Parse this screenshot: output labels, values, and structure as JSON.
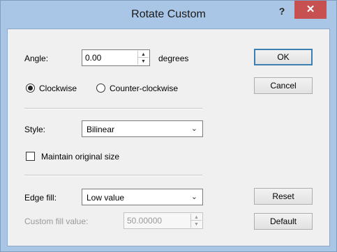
{
  "window": {
    "title": "Rotate Custom",
    "help_label": "?",
    "close_label": "✕"
  },
  "angle": {
    "label": "Angle:",
    "value": "0.00",
    "unit": "degrees"
  },
  "direction": {
    "clockwise_label": "Clockwise",
    "counter_label": "Counter-clockwise",
    "selected": "Clockwise"
  },
  "style": {
    "label": "Style:",
    "value": "Bilinear"
  },
  "maintain": {
    "label": "Maintain original size",
    "checked": false
  },
  "edge_fill": {
    "label": "Edge fill:",
    "value": "Low value"
  },
  "custom_fill": {
    "label": "Custom fill value:",
    "value": "50.00000"
  },
  "buttons": {
    "ok": "OK",
    "cancel": "Cancel",
    "reset": "Reset",
    "default": "Default"
  },
  "icons": {
    "spin_up": "▲",
    "spin_down": "▼",
    "chevron": "⌄"
  },
  "colors": {
    "title_bar": "#a9c6e6",
    "close_button": "#c75050",
    "dialog_bg": "#f0f0f0",
    "default_button_border": "#3c7fb1"
  }
}
